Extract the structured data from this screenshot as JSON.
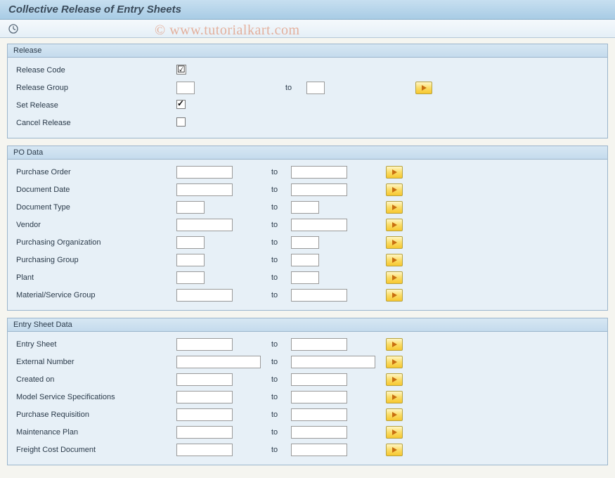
{
  "title": "Collective Release of Entry Sheets",
  "watermark": "© www.tutorialkart.com",
  "toolbar": {
    "execute_icon": "execute-clock-icon"
  },
  "common": {
    "to_label": "to"
  },
  "groups": {
    "release": {
      "title": "Release",
      "fields": {
        "release_code": {
          "label": "Release Code",
          "type": "required_check",
          "value": ""
        },
        "release_group": {
          "label": "Release Group",
          "type": "range_tiny",
          "from": "",
          "to": "",
          "multi": true
        },
        "set_release": {
          "label": "Set Release",
          "type": "check",
          "checked": true
        },
        "cancel_release": {
          "label": "Cancel Release",
          "type": "check",
          "checked": false
        }
      }
    },
    "po_data": {
      "title": "PO Data",
      "fields": [
        {
          "key": "purchase_order",
          "label": "Purchase Order",
          "from": "",
          "to": "",
          "size": "med",
          "multi": true
        },
        {
          "key": "document_date",
          "label": "Document Date",
          "from": "",
          "to": "",
          "size": "med",
          "multi": true
        },
        {
          "key": "document_type",
          "label": "Document Type",
          "from": "",
          "to": "",
          "size": "short",
          "multi": true
        },
        {
          "key": "vendor",
          "label": "Vendor",
          "from": "",
          "to": "",
          "size": "med",
          "multi": true
        },
        {
          "key": "purch_org",
          "label": "Purchasing Organization",
          "from": "",
          "to": "",
          "size": "short",
          "multi": true
        },
        {
          "key": "purch_group",
          "label": "Purchasing Group",
          "from": "",
          "to": "",
          "size": "short",
          "multi": true
        },
        {
          "key": "plant",
          "label": "Plant",
          "from": "",
          "to": "",
          "size": "short",
          "multi": true
        },
        {
          "key": "mat_svc_group",
          "label": "Material/Service Group",
          "from": "",
          "to": "",
          "size": "med",
          "multi": true
        }
      ]
    },
    "entry_sheet_data": {
      "title": "Entry Sheet Data",
      "fields": [
        {
          "key": "entry_sheet",
          "label": "Entry Sheet",
          "from": "",
          "to": "",
          "size": "med",
          "multi": true
        },
        {
          "key": "external_number",
          "label": "External Number",
          "from": "",
          "to": "",
          "size": "long",
          "multi": true
        },
        {
          "key": "created_on",
          "label": "Created on",
          "from": "",
          "to": "",
          "size": "med",
          "multi": true
        },
        {
          "key": "model_svc_spec",
          "label": "Model Service Specifications",
          "from": "",
          "to": "",
          "size": "med",
          "multi": true
        },
        {
          "key": "purchase_req",
          "label": "Purchase Requisition",
          "from": "",
          "to": "",
          "size": "med",
          "multi": true
        },
        {
          "key": "maint_plan",
          "label": "Maintenance Plan",
          "from": "",
          "to": "",
          "size": "med",
          "multi": true
        },
        {
          "key": "freight_cost_doc",
          "label": "Freight Cost Document",
          "from": "",
          "to": "",
          "size": "med",
          "multi": true
        }
      ]
    }
  }
}
